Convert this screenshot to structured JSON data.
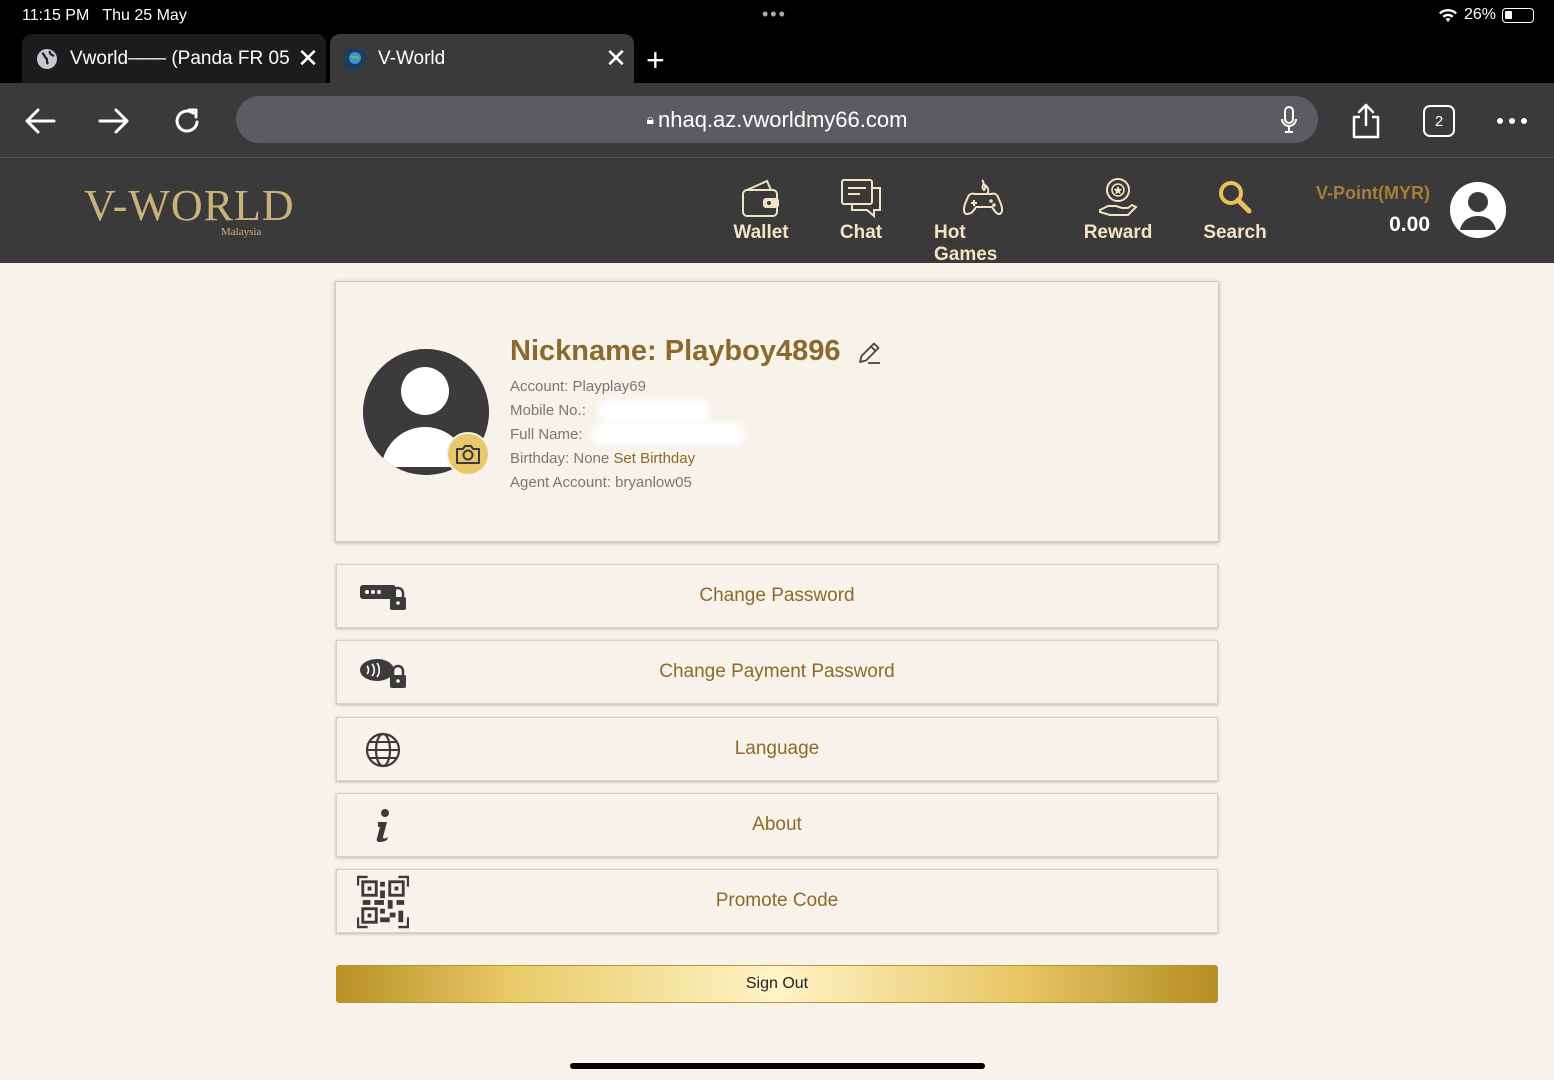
{
  "status_bar": {
    "time": "11:15 PM",
    "date": "Thu 25 May",
    "battery": "26%"
  },
  "browser": {
    "tabs": [
      {
        "title": "Vworld—— (Panda FR 05"
      },
      {
        "title": "V-World"
      }
    ],
    "url": "nhaq.az.vworldmy66.com",
    "tab_count": "2"
  },
  "site": {
    "logo": {
      "main": "V-WORLD",
      "sub": "Malaysia"
    },
    "nav": [
      {
        "label": "Wallet",
        "icon": "wallet-icon"
      },
      {
        "label": "Chat",
        "icon": "chat-icon"
      },
      {
        "label": "Hot Games",
        "icon": "gamepad-icon"
      },
      {
        "label": "Reward",
        "icon": "reward-icon"
      },
      {
        "label": "Search",
        "icon": "search-icon"
      }
    ],
    "vpoint": {
      "label": "V-Point(MYR)",
      "value": "0.00"
    }
  },
  "profile": {
    "nickname": "Nickname: Playboy4896",
    "account": "Account: Playplay69",
    "mobile_label": "Mobile No.:",
    "fullname_label": "Full Name:",
    "birthday_label": "Birthday: None",
    "set_birthday": "Set Birthday",
    "agent_account": "Agent Account: bryanlow05"
  },
  "menu": [
    {
      "label": "Change Password",
      "icon": "password-lock-icon"
    },
    {
      "label": "Change Payment Password",
      "icon": "payment-lock-icon"
    },
    {
      "label": "Language",
      "icon": "globe-icon"
    },
    {
      "label": "About",
      "icon": "info-icon"
    },
    {
      "label": "Promote Code",
      "icon": "qr-code-icon"
    }
  ],
  "sign_out": "Sign Out",
  "colors": {
    "gold": "#8b6a2c",
    "header_bg": "#3a3a3a",
    "page_bg": "#f7f3ea"
  }
}
